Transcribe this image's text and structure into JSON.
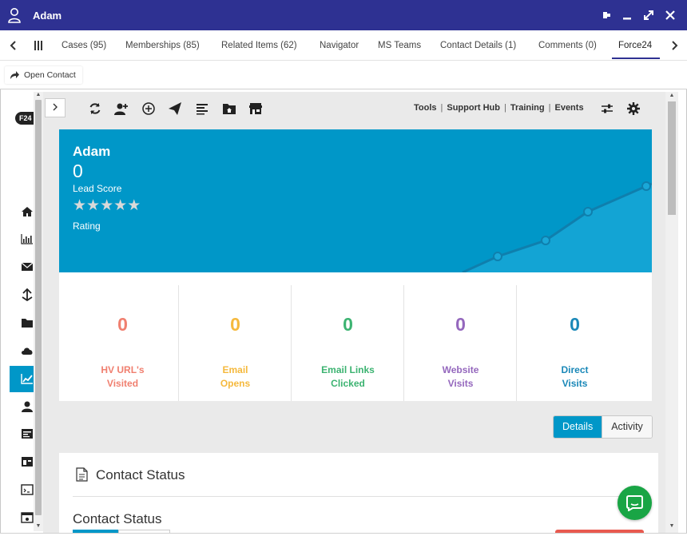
{
  "window": {
    "title": "Adam"
  },
  "tabs": [
    {
      "label": "Cases (95)"
    },
    {
      "label": "Memberships (85)"
    },
    {
      "label": "Related Items (62)"
    },
    {
      "label": "Navigator"
    },
    {
      "label": "MS Teams"
    },
    {
      "label": "Contact Details (1)"
    },
    {
      "label": "Comments (0)"
    },
    {
      "label": "Force24",
      "active": true
    }
  ],
  "command_bar": {
    "open_contact_label": "Open Contact"
  },
  "sidebar": {
    "logo_text": "F24",
    "icons": [
      "home-icon",
      "bar-chart-icon",
      "mail-icon",
      "share-icon",
      "folder-icon",
      "cloud-icon",
      "trend-chart-icon",
      "user-icon",
      "form-icon",
      "layout-icon",
      "code-icon",
      "browser-icon"
    ],
    "active_icon": "trend-chart-icon"
  },
  "toolbar": {
    "icons": [
      "refresh-icon",
      "add-user-icon",
      "add-circle-icon",
      "send-icon",
      "list-icon",
      "folder-home-icon",
      "store-icon"
    ],
    "links": [
      "Tools",
      "Support Hub",
      "Training",
      "Events"
    ],
    "right_icons": [
      "sliders-icon",
      "settings-icon"
    ]
  },
  "hero": {
    "name": "Adam",
    "lead_score": "0",
    "lead_score_label": "Lead Score",
    "rating_stars": 5,
    "rating_filled": 0,
    "rating_label": "Rating",
    "colors": {
      "background": "#0097c8"
    }
  },
  "stats": [
    {
      "value": "0",
      "label_line1": "HV URL's",
      "label_line2": "Visited",
      "color": "#f07f6f"
    },
    {
      "value": "0",
      "label_line1": "Email",
      "label_line2": "Opens",
      "color": "#f5b93d"
    },
    {
      "value": "0",
      "label_line1": "Email Links",
      "label_line2": "Clicked",
      "color": "#3cb371"
    },
    {
      "value": "0",
      "label_line1": "Website",
      "label_line2": "Visits",
      "color": "#9467bd"
    },
    {
      "value": "0",
      "label_line1": "Direct",
      "label_line2": "Visits",
      "color": "#1a88b8"
    }
  ],
  "view_toggle": {
    "details_label": "Details",
    "activity_label": "Activity",
    "selected": "Details"
  },
  "contact_status_panel": {
    "heading": "Contact Status",
    "subheading": "Contact Status"
  }
}
